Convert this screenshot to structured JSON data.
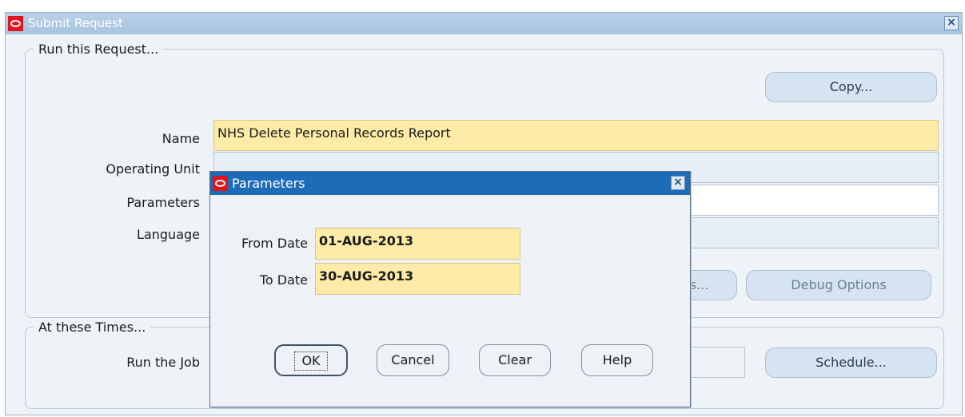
{
  "window": {
    "title": "Submit Request",
    "close": "×"
  },
  "run_group": {
    "legend": "Run this Request...",
    "copy_button": "Copy...",
    "fields": {
      "name_label": "Name",
      "name_value": "NHS Delete Personal Records Report",
      "operating_unit_label": "Operating Unit",
      "operating_unit_value": "",
      "parameters_label": "Parameters",
      "parameters_value": "",
      "language_label": "Language",
      "language_value": ""
    },
    "options_button_partial": "s...",
    "debug_button": "Debug Options"
  },
  "times_group": {
    "legend": "At these Times...",
    "run_job_label": "Run the Job",
    "schedule_button": "Schedule..."
  },
  "parameters_dialog": {
    "title": "Parameters",
    "close": "×",
    "from_date_label": "From Date",
    "from_date_value": "01-AUG-2013",
    "to_date_label": "To Date",
    "to_date_value": "30-AUG-2013",
    "buttons": {
      "ok": "OK",
      "cancel": "Cancel",
      "clear": "Clear",
      "help": "Help"
    }
  }
}
